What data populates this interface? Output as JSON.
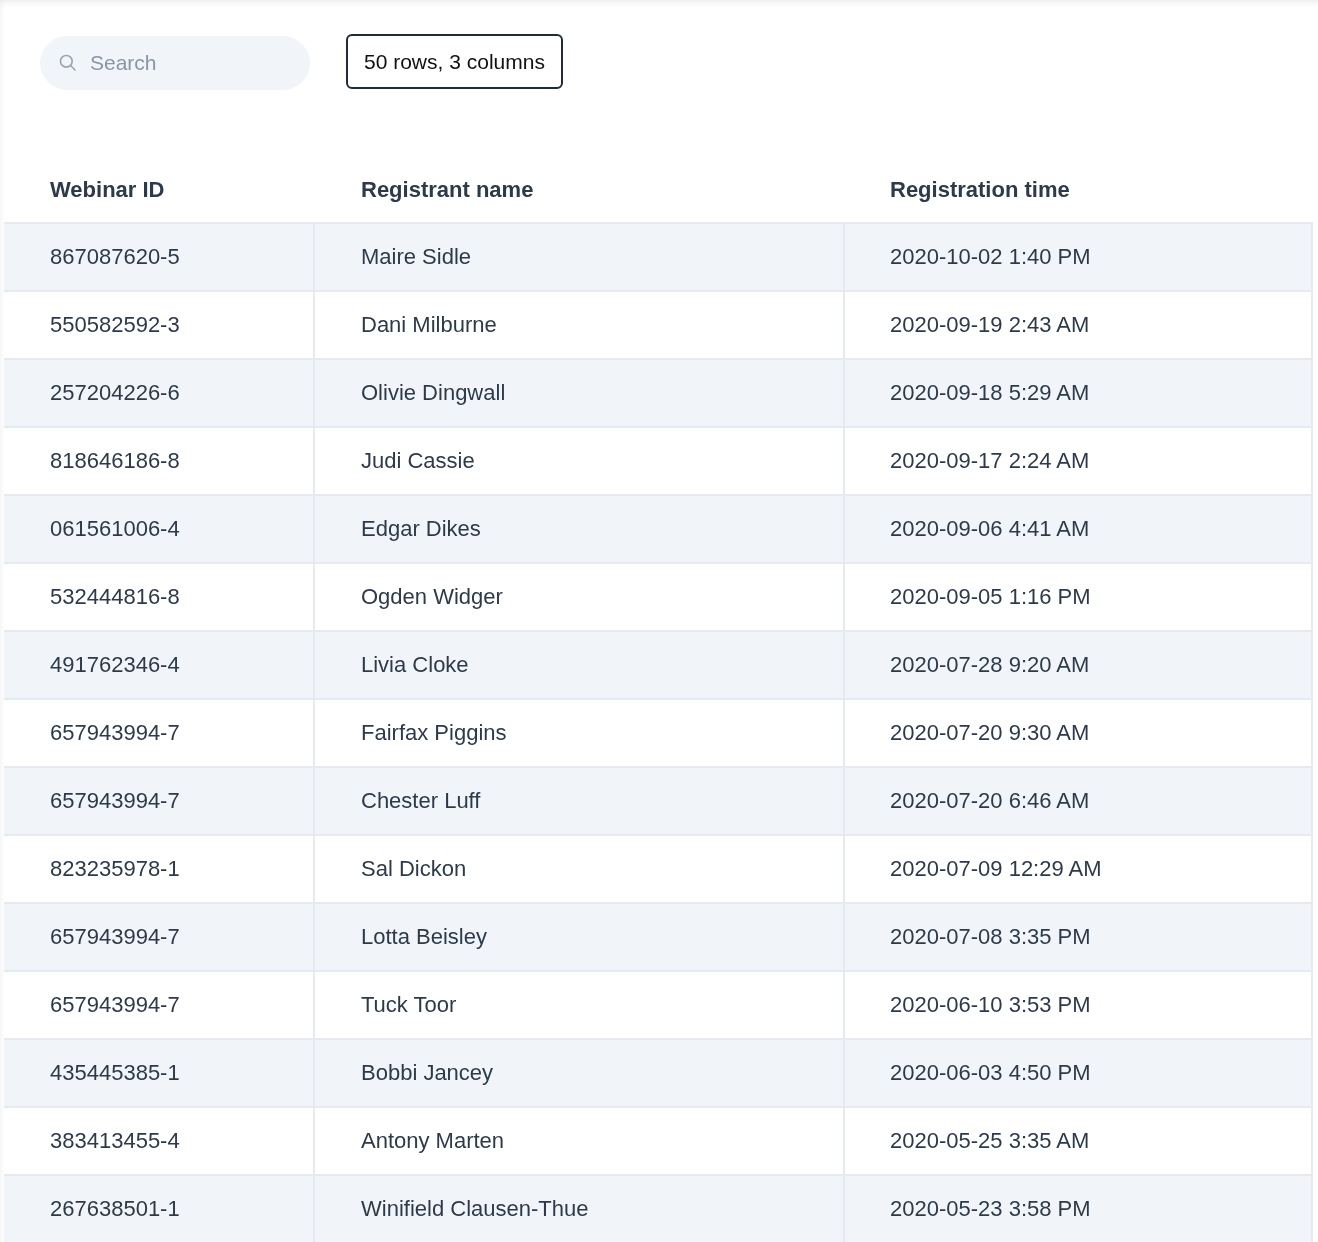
{
  "search": {
    "placeholder": "Search"
  },
  "summary": "50 rows, 3 columns",
  "table": {
    "columns": [
      "Webinar ID",
      "Registrant name",
      "Registration time"
    ],
    "rows": [
      [
        "867087620-5",
        "Maire Sidle",
        "2020-10-02 1:40 PM"
      ],
      [
        "550582592-3",
        "Dani Milburne",
        "2020-09-19 2:43 AM"
      ],
      [
        "257204226-6",
        "Olivie Dingwall",
        "2020-09-18 5:29 AM"
      ],
      [
        "818646186-8",
        "Judi Cassie",
        "2020-09-17 2:24 AM"
      ],
      [
        "061561006-4",
        "Edgar Dikes",
        "2020-09-06 4:41 AM"
      ],
      [
        "532444816-8",
        "Ogden Widger",
        "2020-09-05 1:16 PM"
      ],
      [
        "491762346-4",
        "Livia Cloke",
        "2020-07-28 9:20 AM"
      ],
      [
        "657943994-7",
        "Fairfax Piggins",
        "2020-07-20 9:30 AM"
      ],
      [
        "657943994-7",
        "Chester Luff",
        "2020-07-20 6:46 AM"
      ],
      [
        "823235978-1",
        "Sal Dickon",
        "2020-07-09 12:29 AM"
      ],
      [
        "657943994-7",
        "Lotta Beisley",
        "2020-07-08 3:35 PM"
      ],
      [
        "657943994-7",
        "Tuck Toor",
        "2020-06-10 3:53 PM"
      ],
      [
        "435445385-1",
        "Bobbi Jancey",
        "2020-06-03 4:50 PM"
      ],
      [
        "383413455-4",
        "Antony Marten",
        "2020-05-25 3:35 AM"
      ],
      [
        "267638501-1",
        "Winifield Clausen-Thue",
        "2020-05-23 3:58 PM"
      ]
    ]
  }
}
